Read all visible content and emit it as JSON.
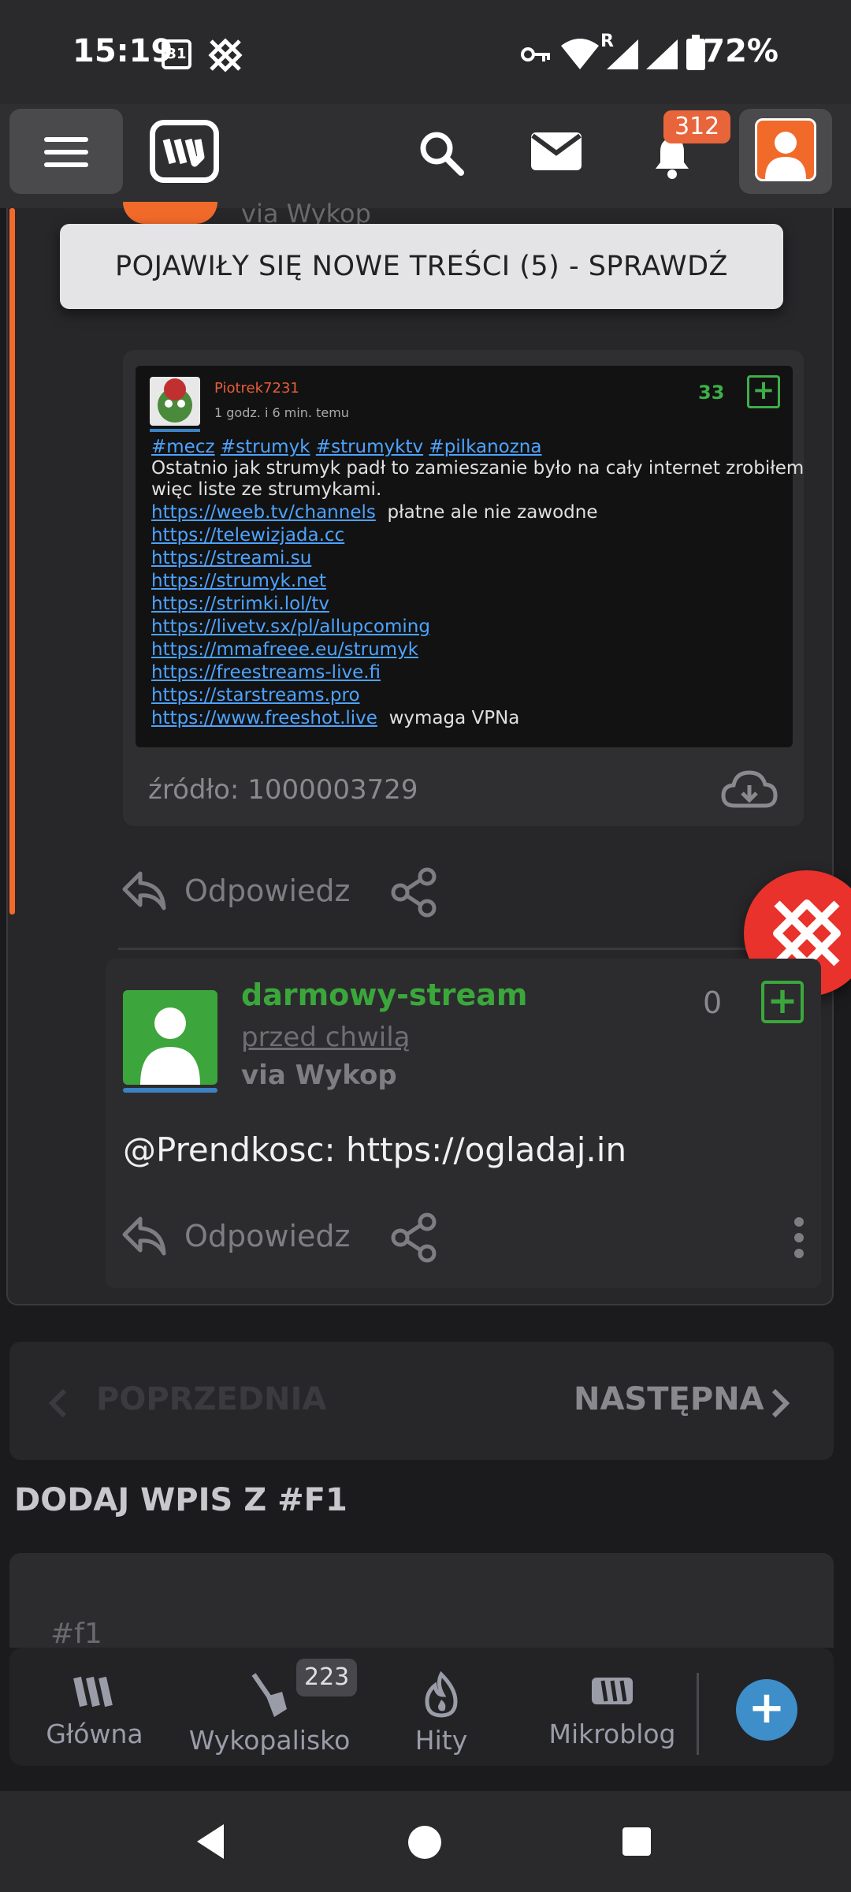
{
  "status_bar": {
    "time": "15:19",
    "calendar_day": "31",
    "signal_label": "R",
    "battery": "72%"
  },
  "app_bar": {
    "notification_count": "312"
  },
  "banner": {
    "new_content": "POJAWIŁY SIĘ NOWE TREŚCI (5) - SPRAWDŹ"
  },
  "hidden_meta": "via Wykop",
  "embed": {
    "author": "Piotrek7231",
    "time": "1 godz. i 6 min. temu",
    "score": "33",
    "tags": [
      "#mecz",
      "#strumyk",
      "#strumyktv",
      "#pilkanozna"
    ],
    "body_line1": "Ostatnio jak strumyk padł to zamieszanie było na cały internet zrobiłem",
    "body_line2": "więc liste ze strumykami.",
    "links": [
      {
        "url": "https://weeb.tv/channels",
        "note": "płatne ale nie zawodne"
      },
      {
        "url": "https://telewizjada.cc",
        "note": ""
      },
      {
        "url": "https://streami.su",
        "note": ""
      },
      {
        "url": "https://strumyk.net",
        "note": ""
      },
      {
        "url": "https://strimki.lol/tv",
        "note": ""
      },
      {
        "url": "https://livetv.sx/pl/allupcoming",
        "note": ""
      },
      {
        "url": "https://mmafreee.eu/strumyk",
        "note": ""
      },
      {
        "url": "https://freestreams-live.fi",
        "note": ""
      },
      {
        "url": "https://starstreams.pro",
        "note": ""
      },
      {
        "url": "https://www.freeshot.live",
        "note": "wymaga VPNa"
      }
    ],
    "source": "źródło: 1000003729"
  },
  "reply_label": "Odpowiedz",
  "comment": {
    "author": "darmowy-stream",
    "time": "przed chwilą",
    "via": "via Wykop",
    "score": "0",
    "body": "@Prendkosc: https://ogladaj.in"
  },
  "pagination": {
    "prev": "POPRZEDNIA",
    "next": "NASTĘPNA"
  },
  "add_entry": {
    "title": "DODAJ WPIS Z #F1",
    "tag": "#f1"
  },
  "bottom_nav": {
    "items": [
      "Główna",
      "Wykopalisko",
      "Hity",
      "Mikroblog"
    ],
    "wykopalisko_badge": "223"
  },
  "colors": {
    "accent": "#f26a2a",
    "green": "#3ba73b",
    "link": "#4da3ff",
    "fab": "#3d8ec9"
  }
}
